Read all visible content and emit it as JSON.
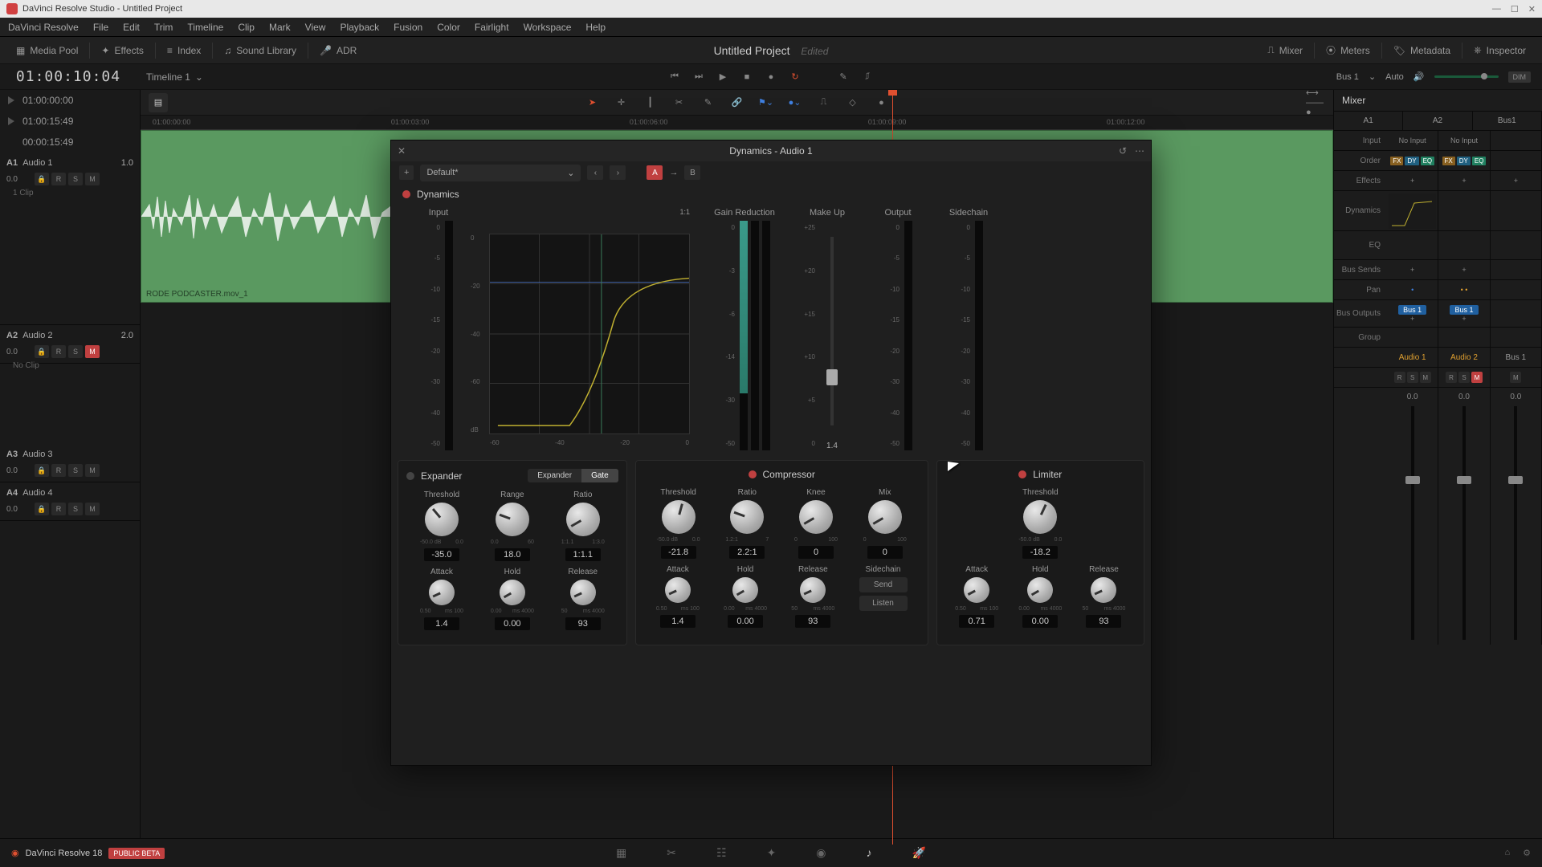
{
  "window": {
    "title": "DaVinci Resolve Studio - Untitled Project"
  },
  "menu": [
    "DaVinci Resolve",
    "File",
    "Edit",
    "Trim",
    "Timeline",
    "Clip",
    "Mark",
    "View",
    "Playback",
    "Fusion",
    "Color",
    "Fairlight",
    "Workspace",
    "Help"
  ],
  "toolbar": {
    "media_pool": "Media Pool",
    "effects": "Effects",
    "index": "Index",
    "sound_lib": "Sound Library",
    "adr": "ADR",
    "project": "Untitled Project",
    "edited": "Edited",
    "mixer": "Mixer",
    "meters": "Meters",
    "metadata": "Metadata",
    "inspector": "Inspector"
  },
  "transport": {
    "timecode": "01:00:10:04",
    "timeline": "Timeline 1",
    "bus": "Bus 1",
    "auto": "Auto",
    "dim": "DIM"
  },
  "tc_rows": [
    "01:00:00:00",
    "01:00:15:49",
    "00:00:15:49"
  ],
  "tracks": [
    {
      "id": "A1",
      "name": "Audio 1",
      "val": "1.0",
      "level": "0.0",
      "clip": "1 Clip",
      "clipname": "RODE PODCASTER.mov_1",
      "mute": false
    },
    {
      "id": "A2",
      "name": "Audio 2",
      "val": "2.0",
      "level": "0.0",
      "clip": "No Clip",
      "mute": true
    },
    {
      "id": "A3",
      "name": "Audio 3",
      "val": "",
      "level": "0.0",
      "mute": false
    },
    {
      "id": "A4",
      "name": "Audio 4",
      "val": "",
      "level": "0.0",
      "mute": false
    }
  ],
  "ruler": [
    "01:00:00:00",
    "01:00:03:00",
    "01:00:06:00",
    "01:00:09:00",
    "01:00:12:00"
  ],
  "mixer": {
    "title": "Mixer",
    "channels": [
      "A1",
      "A2",
      "Bus1"
    ],
    "rows": {
      "input": "Input",
      "order": "Order",
      "effects": "Effects",
      "dynamics": "Dynamics",
      "eq": "EQ",
      "bus_sends": "Bus Sends",
      "pan": "Pan",
      "bus_outputs": "Bus Outputs",
      "group": "Group"
    },
    "inputs": [
      "No Input",
      "No Input",
      ""
    ],
    "bus": "Bus 1",
    "names": [
      "Audio 1",
      "Audio 2",
      "Bus 1"
    ],
    "fader_vals": [
      "0.0",
      "0.0",
      "0.0"
    ]
  },
  "dynamics": {
    "title": "Dynamics - Audio 1",
    "preset": "Default*",
    "section": "Dynamics",
    "labels": {
      "input": "Input",
      "gain_red": "Gain Reduction",
      "makeup": "Make Up",
      "output": "Output",
      "sidechain": "Sidechain"
    },
    "graph_ratio": "1:1",
    "graph_x": [
      "-60",
      "-40",
      "-20",
      "0"
    ],
    "graph_y": [
      "0",
      "-20",
      "-40",
      "-60",
      "dB"
    ],
    "makeup_scale": [
      "+25",
      "+20",
      "+15",
      "+10",
      "+5",
      "0"
    ],
    "makeup_val": "1.4",
    "gr_scale": [
      "0",
      "-3",
      "-6",
      "-14",
      "-30",
      "-50"
    ],
    "out_scale": [
      "0",
      "-5",
      "-10",
      "-15",
      "-20",
      "-30",
      "-40",
      "-50"
    ],
    "input_scale": [
      "0",
      "-5",
      "-10",
      "-15",
      "-20",
      "-30",
      "-40",
      "-50"
    ],
    "modules": {
      "expander": {
        "name": "Expander",
        "gate": "Gate",
        "knobs": [
          {
            "l": "Threshold",
            "r": [
              "-50.0 dB",
              "0.0"
            ],
            "v": "-35.0",
            "rot": -40
          },
          {
            "l": "Range",
            "r": [
              "0.0",
              "60"
            ],
            "v": "18.0",
            "rot": -70
          },
          {
            "l": "Ratio",
            "r": [
              "1:1.1",
              "1:3.0"
            ],
            "v": "1:1.1",
            "rot": -120
          }
        ],
        "knobs2": [
          {
            "l": "Attack",
            "r": [
              "0.50",
              "ms 100"
            ],
            "v": "1.4",
            "rot": -115
          },
          {
            "l": "Hold",
            "r": [
              "0.00",
              "ms 4000"
            ],
            "v": "0.00",
            "rot": -120
          },
          {
            "l": "Release",
            "r": [
              "50",
              "ms 4000"
            ],
            "v": "93",
            "rot": -115
          }
        ]
      },
      "compressor": {
        "name": "Compressor",
        "knobs": [
          {
            "l": "Threshold",
            "r": [
              "-50.0 dB",
              "0.0"
            ],
            "v": "-21.8",
            "rot": 15
          },
          {
            "l": "Ratio",
            "r": [
              "1.2:1",
              "7"
            ],
            "v": "2.2:1",
            "rot": -70
          },
          {
            "l": "Knee",
            "r": [
              "0",
              "100"
            ],
            "v": "0",
            "rot": -120
          },
          {
            "l": "Mix",
            "r": [
              "0",
              "100"
            ],
            "v": "0",
            "rot": -120
          }
        ],
        "knobs2": [
          {
            "l": "Attack",
            "r": [
              "0.50",
              "ms 100"
            ],
            "v": "1.4",
            "rot": -115
          },
          {
            "l": "Hold",
            "r": [
              "0.00",
              "ms 4000"
            ],
            "v": "0.00",
            "rot": -120
          },
          {
            "l": "Release",
            "r": [
              "50",
              "ms 4000"
            ],
            "v": "93",
            "rot": -115
          }
        ],
        "sidechain": "Sidechain",
        "send": "Send",
        "listen": "Listen"
      },
      "limiter": {
        "name": "Limiter",
        "knobs": [
          {
            "l": "Threshold",
            "r": [
              "-50.0 dB",
              "0.0"
            ],
            "v": "-18.2",
            "rot": 25
          }
        ],
        "knobs2": [
          {
            "l": "Attack",
            "r": [
              "0.50",
              "ms 100"
            ],
            "v": "0.71",
            "rot": -118
          },
          {
            "l": "Hold",
            "r": [
              "0.00",
              "ms 4000"
            ],
            "v": "0.00",
            "rot": -120
          },
          {
            "l": "Release",
            "r": [
              "50",
              "ms 4000"
            ],
            "v": "93",
            "rot": -115
          }
        ]
      }
    }
  },
  "footer": {
    "app": "DaVinci Resolve 18",
    "beta": "PUBLIC BETA"
  }
}
